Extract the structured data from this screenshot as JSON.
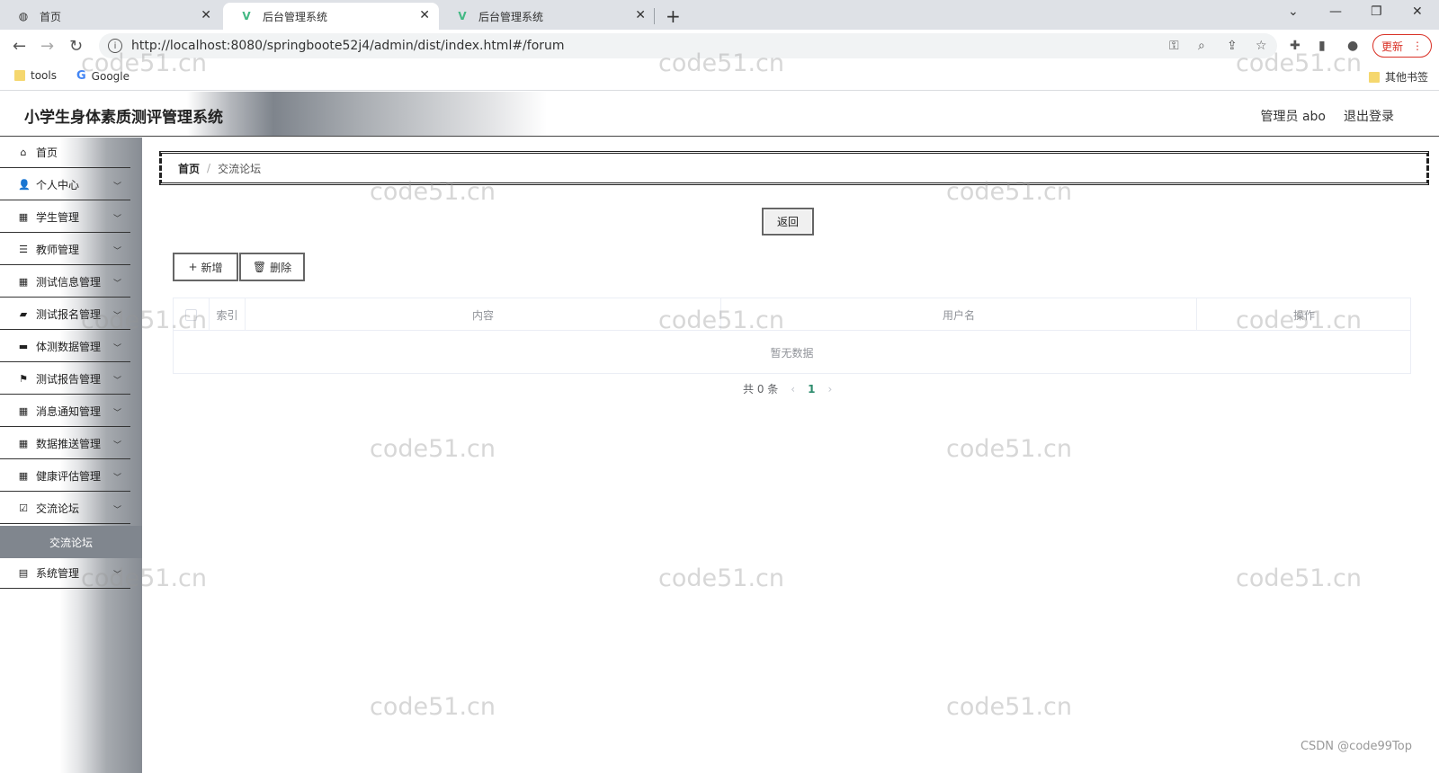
{
  "browser": {
    "tabs": [
      {
        "title": "首页"
      },
      {
        "title": "后台管理系统"
      },
      {
        "title": "后台管理系统"
      }
    ],
    "url": "http://localhost:8080/springboote52j4/admin/dist/index.html#/forum",
    "update_label": "更新",
    "bookmarks": [
      {
        "label": "tools"
      },
      {
        "label": "Google"
      }
    ],
    "other_bookmarks": "其他书签"
  },
  "header": {
    "title": "小学生身体素质测评管理系统",
    "user_label": "管理员 abo",
    "logout_label": "退出登录"
  },
  "sidebar": {
    "items": [
      {
        "label": "首页",
        "icon": "home-icon"
      },
      {
        "label": "个人中心",
        "icon": "user-icon"
      },
      {
        "label": "学生管理",
        "icon": "grid-icon"
      },
      {
        "label": "教师管理",
        "icon": "list-icon"
      },
      {
        "label": "测试信息管理",
        "icon": "grid-icon"
      },
      {
        "label": "测试报名管理",
        "icon": "book-icon"
      },
      {
        "label": "体测数据管理",
        "icon": "briefcase-icon"
      },
      {
        "label": "测试报告管理",
        "icon": "flag-icon"
      },
      {
        "label": "消息通知管理",
        "icon": "grid-icon"
      },
      {
        "label": "数据推送管理",
        "icon": "grid-icon"
      },
      {
        "label": "健康评估管理",
        "icon": "grid-icon"
      },
      {
        "label": "交流论坛",
        "icon": "clipboard-icon"
      },
      {
        "label": "系统管理",
        "icon": "chart-icon"
      }
    ],
    "active_sub": "交流论坛"
  },
  "breadcrumb": {
    "home": "首页",
    "separator": "/",
    "current": "交流论坛"
  },
  "actions": {
    "back": "返回",
    "add": "新增",
    "delete": "删除"
  },
  "table": {
    "columns": [
      "索引",
      "内容",
      "用户名",
      "操作"
    ],
    "empty_text": "暂无数据"
  },
  "pagination": {
    "total_label": "共 0 条",
    "current_page": "1"
  },
  "watermark_text": "code51.cn",
  "footer_credit": "CSDN @code99Top"
}
